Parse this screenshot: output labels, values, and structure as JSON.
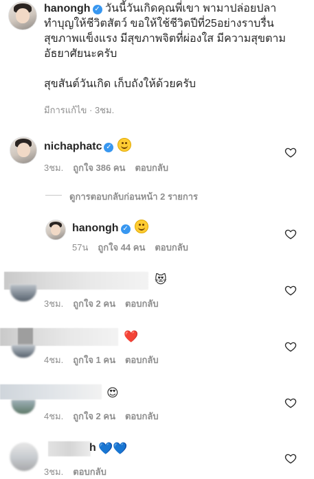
{
  "post": {
    "username": "hanongh",
    "caption": [
      "วันนี้วันเกิดคุณพี่เขา พามาปล่อยปลา",
      "ทำบุญให้ชีวิตสัตว์ ขอให้ใช้ชีวิตปีที่25อย่างราบรื่น",
      "สุขภาพแข็งแรง มีสุขภาพจิตที่ผ่องใส มีความสุขตาม",
      "อัธยาศัยนะครับ",
      "",
      "สุขสันต์วันเกิด เก็บถังให้ด้วยครับ"
    ],
    "edited": "มีการแก้ไข · 3ชม."
  },
  "comments": [
    {
      "username": "nichaphatc",
      "emoji": "smile",
      "time": "3ชม.",
      "likes": "ถูกใจ 386 คน",
      "reply": "ตอบกลับ"
    },
    {
      "view_replies": "ดูการตอบกลับก่อนหน้า 2 รายการ"
    },
    {
      "username": "hanongh",
      "emoji": "smile",
      "time": "57น",
      "likes": "ถูกใจ 44 คน",
      "reply": "ตอบกลับ"
    },
    {
      "emoji": "😻",
      "time": "3ชม.",
      "likes": "ถูกใจ 2 คน",
      "reply": "ตอบกลับ"
    },
    {
      "emoji": "❤️",
      "time": "4ชม.",
      "likes": "ถูกใจ 1 คน",
      "reply": "ตอบกลับ"
    },
    {
      "emoji": "😍",
      "time": "4ชม.",
      "likes": "ถูกใจ 2 คน",
      "reply": "ตอบกลับ"
    },
    {
      "username_tail": "h",
      "emoji": "💙💙",
      "time": "3ชม.",
      "reply": "ตอบกลับ"
    }
  ],
  "icons": {
    "verified": "verified-badge-icon",
    "heart": "heart-outline-icon"
  },
  "colors": {
    "verified": "#3897f0",
    "meta": "#8e8e8e",
    "text": "#262626"
  }
}
